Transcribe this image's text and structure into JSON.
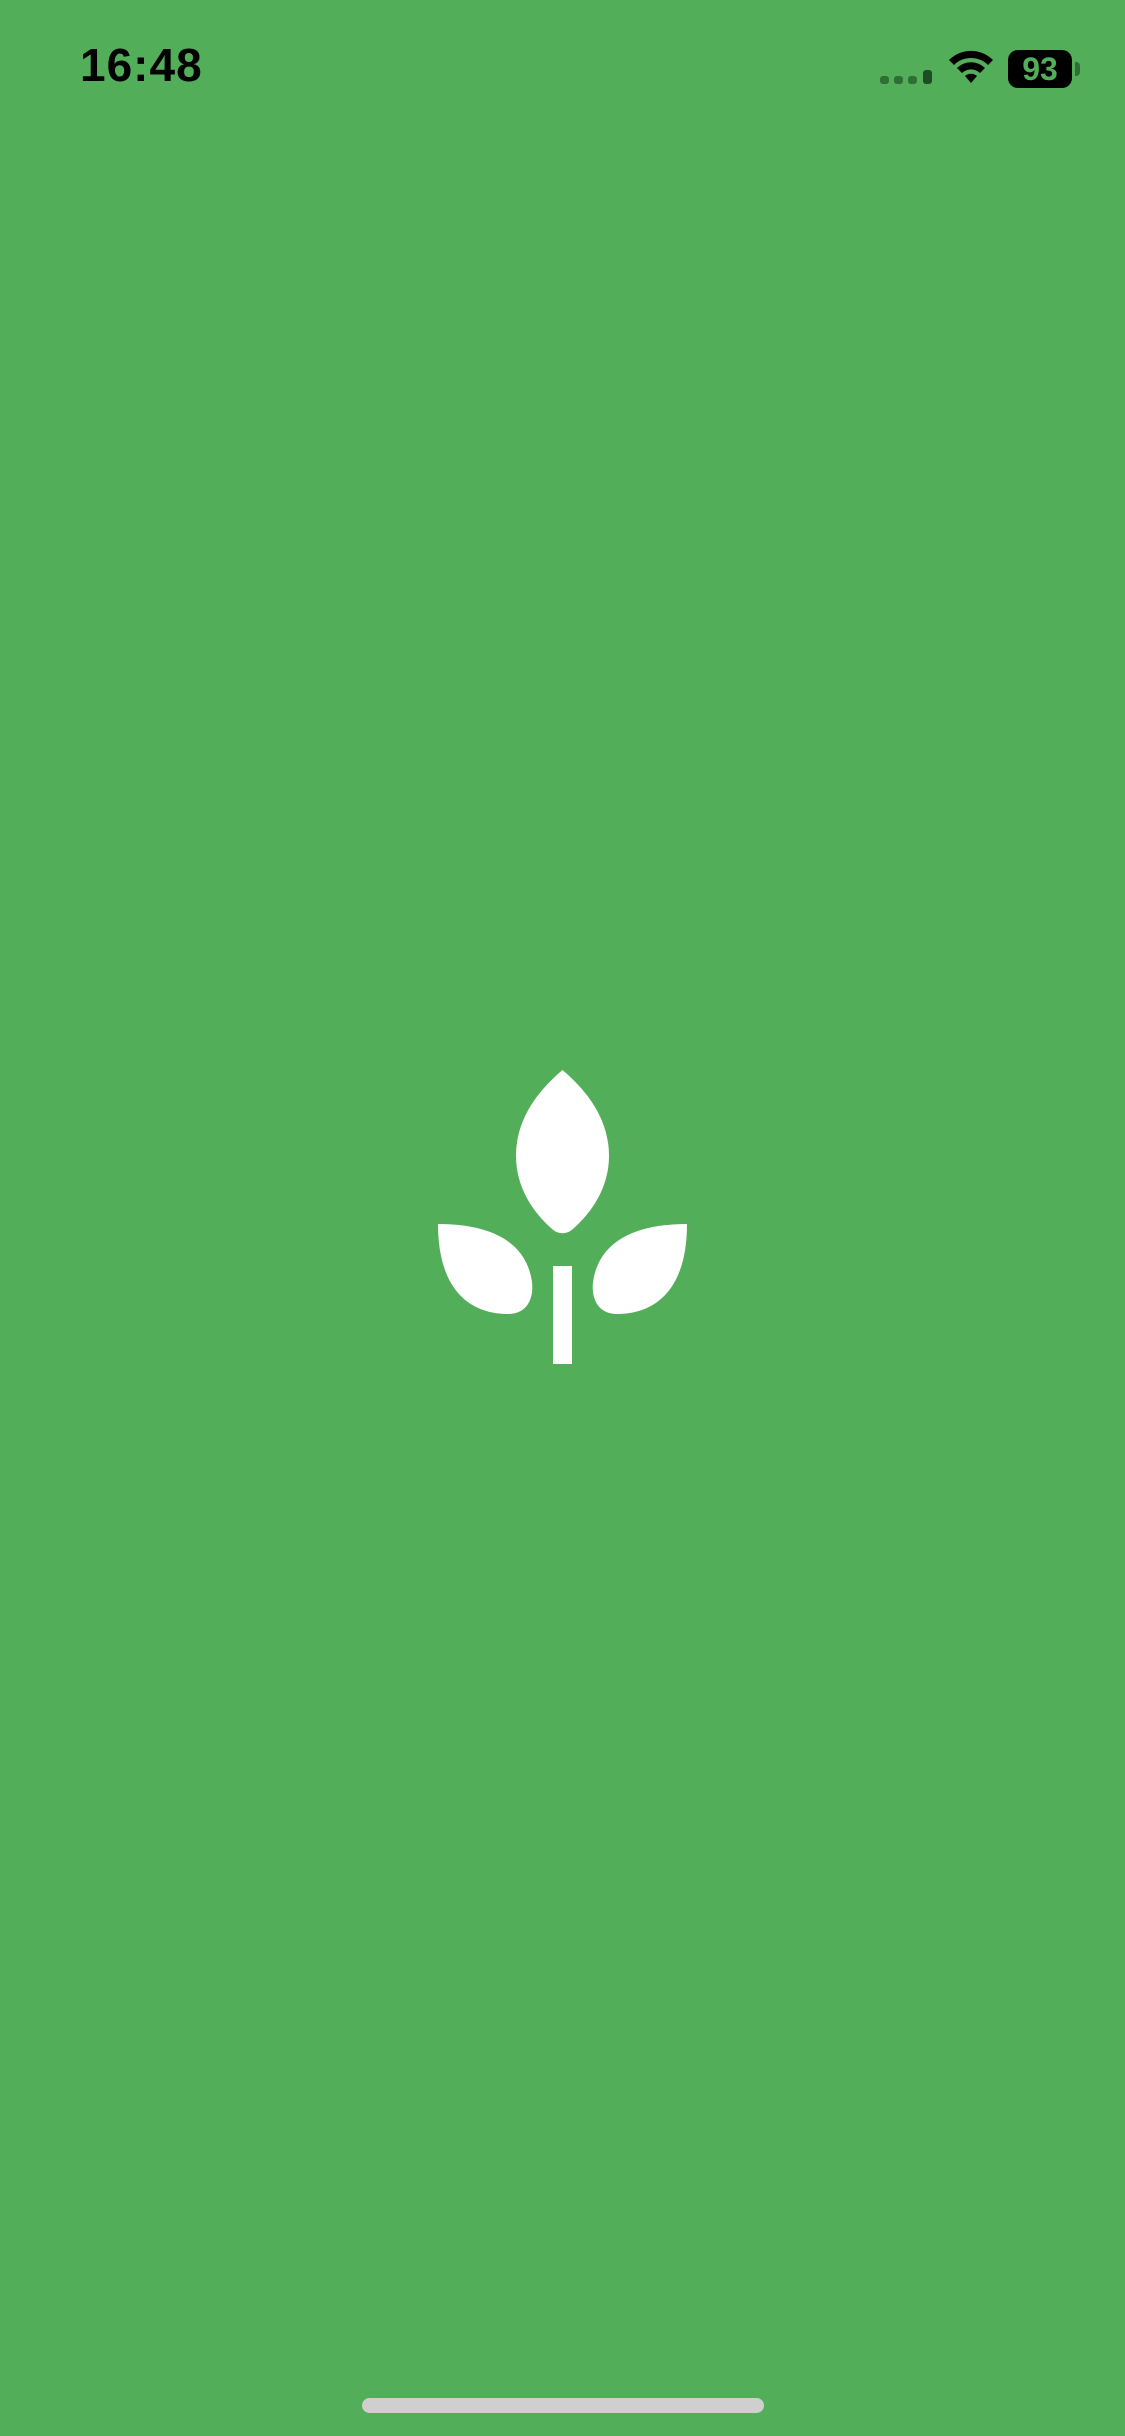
{
  "status_bar": {
    "time": "16:48",
    "battery_level": "93",
    "signal_icon": "cellular-signal-icon",
    "wifi_icon": "wifi-icon"
  },
  "splash": {
    "logo_icon": "sprout-leaf-icon",
    "background_color": "#53ae5a",
    "logo_color": "#ffffff"
  },
  "system": {
    "home_indicator": "home-indicator"
  }
}
